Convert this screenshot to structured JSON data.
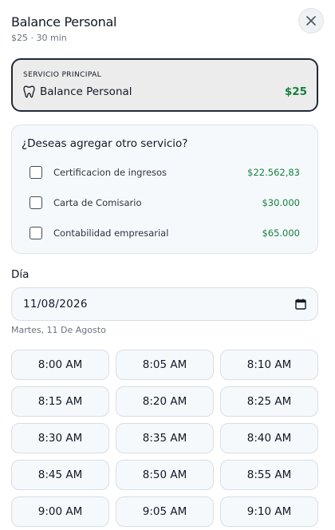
{
  "header": {
    "title": "Balance Personal",
    "subtitle": "$25 · 30 min"
  },
  "main_service": {
    "kicker": "SERVICIO PRINCIPAL",
    "name": "Balance Personal",
    "price": "$25",
    "icon": "tooth-icon"
  },
  "addons": {
    "title": "¿Deseas agregar otro servicio?",
    "items": [
      {
        "name": "Certificacion de ingresos",
        "price": "$22.562,83",
        "checked": false
      },
      {
        "name": "Carta de Comisario",
        "price": "$30.000",
        "checked": false
      },
      {
        "name": "Contabilidad empresarial",
        "price": "$65.000",
        "checked": false
      }
    ]
  },
  "day": {
    "label": "Día",
    "value": "11/08/2026",
    "hint": "Martes, 11 De Agosto",
    "icon": "calendar-icon"
  },
  "slots": [
    "8:00 AM",
    "8:05 AM",
    "8:10 AM",
    "8:15 AM",
    "8:20 AM",
    "8:25 AM",
    "8:30 AM",
    "8:35 AM",
    "8:40 AM",
    "8:45 AM",
    "8:50 AM",
    "8:55 AM",
    "9:00 AM",
    "9:05 AM",
    "9:10 AM"
  ],
  "colors": {
    "price_green": "#15803d",
    "border_dark": "#1f2937"
  }
}
